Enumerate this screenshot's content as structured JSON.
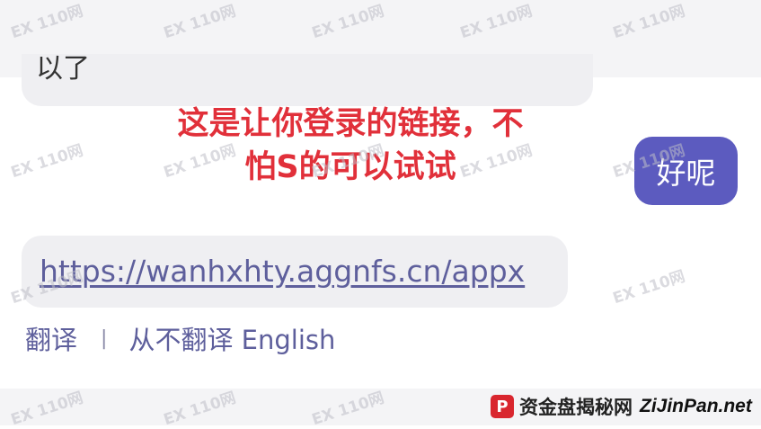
{
  "watermark": {
    "text": "110网",
    "positions_note": ""
  },
  "chat": {
    "previous_message_fragment": "以了",
    "outgoing_message": "好呢",
    "link_message": "https://wanhxhty.aggnfs.cn/appx"
  },
  "annotation": {
    "line1": "这是让你登录的链接，不",
    "line2": "怕S的可以试试"
  },
  "translate_bar": {
    "translate_label": "翻译",
    "separator": "|",
    "never_translate_label": "从不翻译 English"
  },
  "footer_logo": {
    "mark": "P",
    "name_cn": "资金盘揭秘网",
    "name_en": "ZiJinPan.net"
  },
  "colors": {
    "outgoing_bubble": "#5c5bbf",
    "incoming_bubble": "#efeff2",
    "link_text": "#5e5f9c",
    "annotation_red": "#e1303a",
    "logo_red": "#d9262e"
  }
}
